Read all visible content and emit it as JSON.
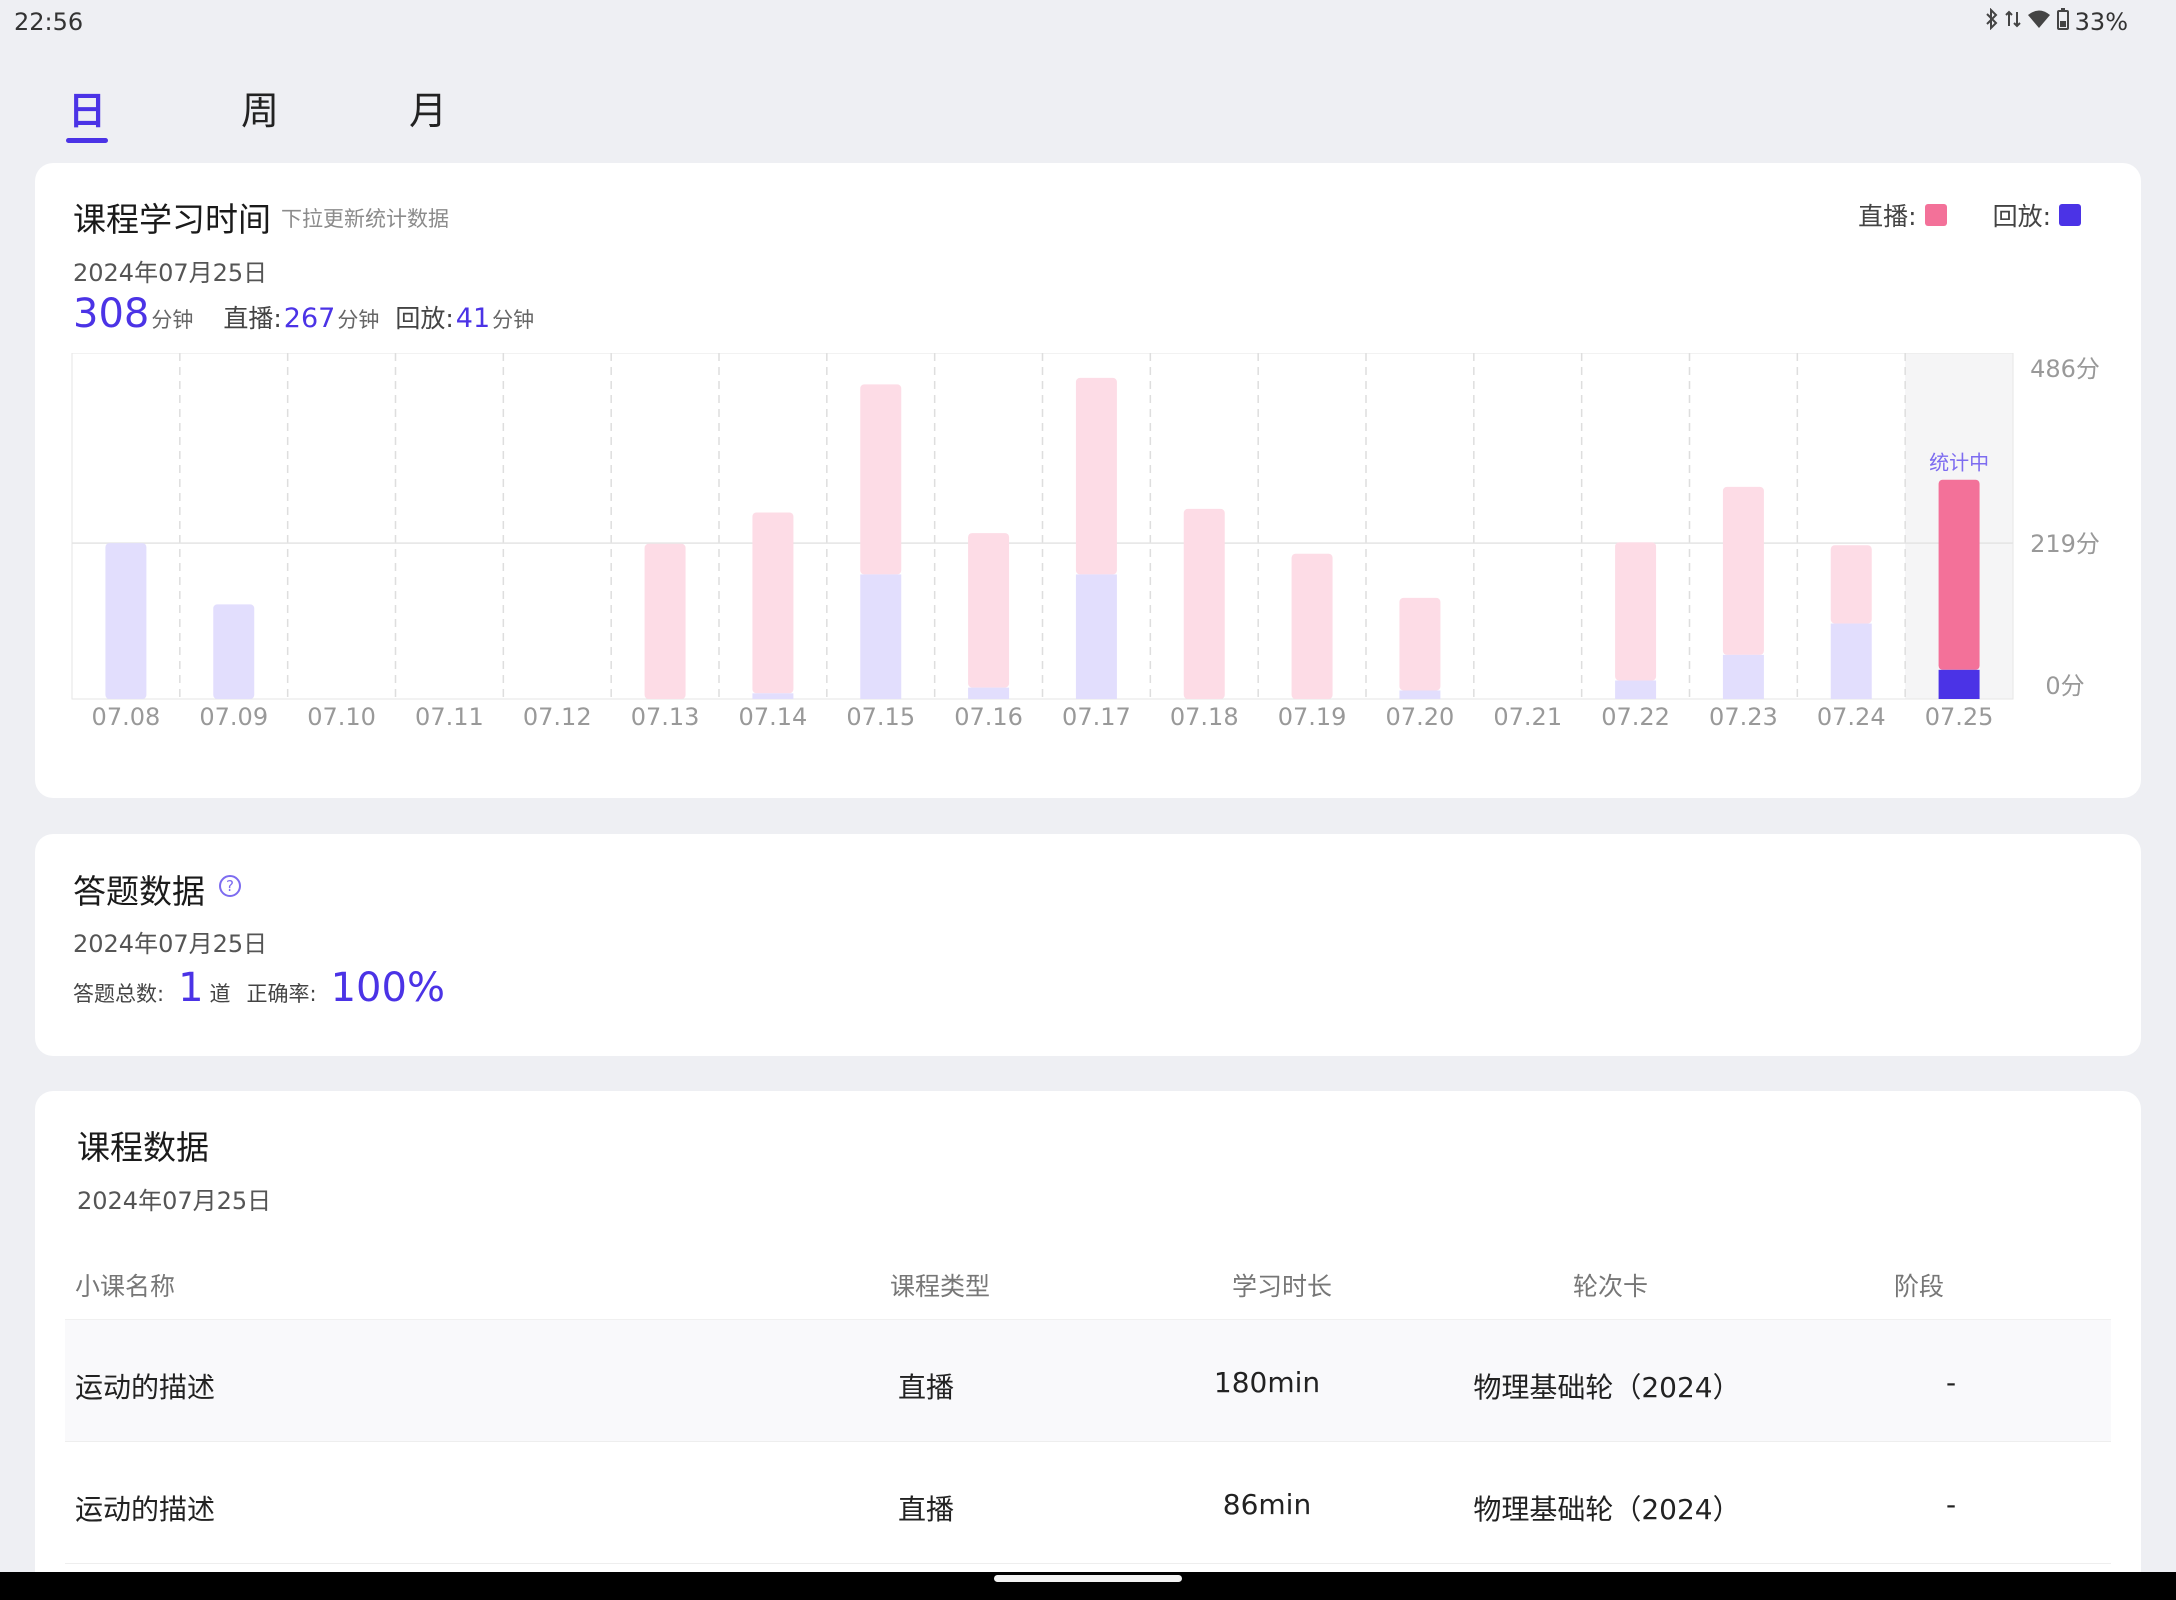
{
  "status_bar": {
    "time": "22:56",
    "battery": "33%",
    "icons": [
      "bluetooth-icon",
      "data-icon",
      "wifi-icon",
      "battery-icon"
    ]
  },
  "tabs": [
    {
      "label": "日",
      "active": true
    },
    {
      "label": "周",
      "active": false
    },
    {
      "label": "月",
      "active": false
    }
  ],
  "study_time": {
    "title": "课程学习时间",
    "subtitle": "下拉更新统计数据",
    "date": "2024年07月25日",
    "legend_live": "直播:",
    "legend_replay": "回放:",
    "total": "308",
    "total_unit": "分钟",
    "live_label": "直播:",
    "live_value": "267",
    "live_unit": "分钟",
    "replay_label": "回放:",
    "replay_value": "41",
    "replay_unit": "分钟"
  },
  "chart_data": {
    "type": "bar",
    "stacked": true,
    "categories": [
      "07.08",
      "07.09",
      "07.10",
      "07.11",
      "07.12",
      "07.13",
      "07.14",
      "07.15",
      "07.16",
      "07.17",
      "07.18",
      "07.19",
      "07.20",
      "07.21",
      "07.22",
      "07.23",
      "07.24",
      "07.25"
    ],
    "series": [
      {
        "name": "回放",
        "color": "#4b33e6",
        "faded_color": "#e2defd",
        "values": [
          219,
          133,
          0,
          0,
          0,
          0,
          8,
          175,
          16,
          175,
          0,
          0,
          12,
          0,
          26,
          62,
          106,
          41
        ]
      },
      {
        "name": "直播",
        "color": "#f37199",
        "faded_color": "#fddce6",
        "values": [
          0,
          0,
          0,
          0,
          0,
          218,
          254,
          267,
          217,
          276,
          267,
          204,
          130,
          0,
          194,
          236,
          110,
          267
        ]
      }
    ],
    "y_ticks": [
      "486分",
      "219分",
      "0分"
    ],
    "ylim": [
      0,
      486
    ],
    "current_index": 17,
    "current_label": "统计中",
    "grid": true
  },
  "answers": {
    "title": "答题数据",
    "date": "2024年07月25日",
    "total_label": "答题总数:",
    "total_value": "1",
    "total_unit": "道",
    "accuracy_label": "正确率:",
    "accuracy_value": "100%"
  },
  "courses": {
    "title": "课程数据",
    "date": "2024年07月25日",
    "columns": [
      "小课名称",
      "课程类型",
      "学习时长",
      "轮次卡",
      "阶段"
    ],
    "rows": [
      {
        "name": "运动的描述",
        "type": "直播",
        "duration": "180min",
        "round": "物理基础轮（2024）",
        "stage": "-"
      },
      {
        "name": "运动的描述",
        "type": "直播",
        "duration": "86min",
        "round": "物理基础轮（2024）",
        "stage": "-"
      }
    ]
  },
  "colors": {
    "accent": "#4b33e6",
    "live": "#f37199",
    "replay": "#4b33e6",
    "background": "#eeeff3"
  }
}
